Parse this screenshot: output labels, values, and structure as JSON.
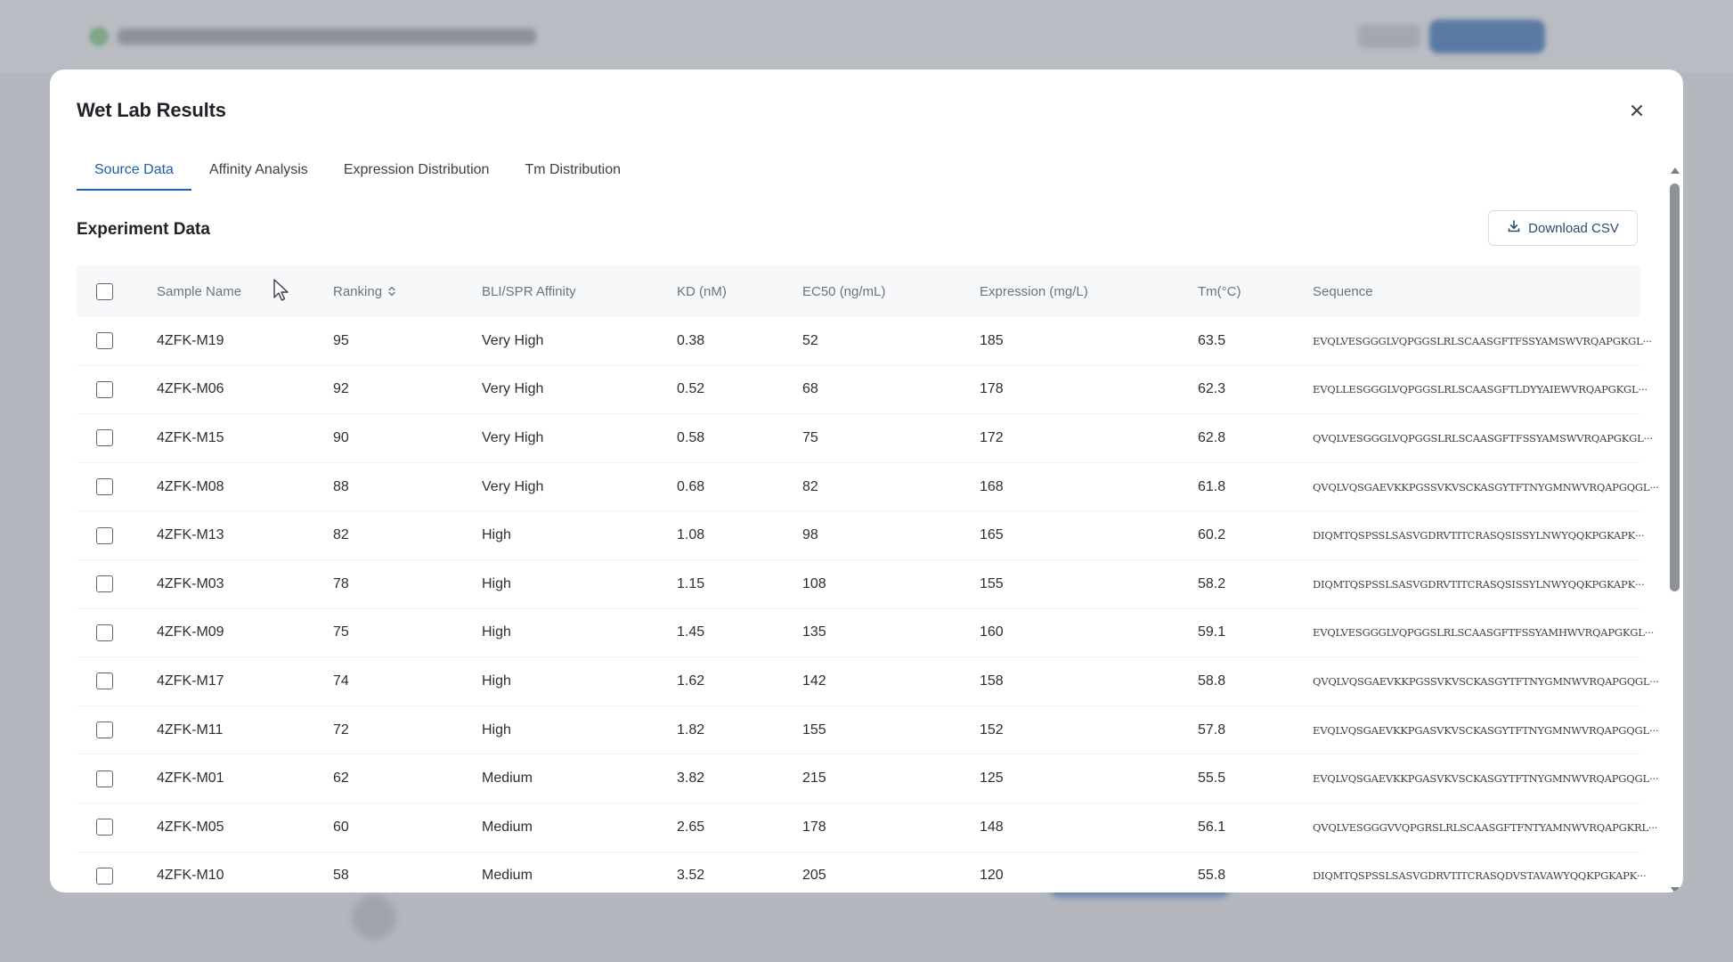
{
  "modal": {
    "title": "Wet Lab Results",
    "close_icon": "close-icon"
  },
  "tabs": [
    {
      "label": "Source Data",
      "active": true
    },
    {
      "label": "Affinity Analysis",
      "active": false
    },
    {
      "label": "Expression Distribution",
      "active": false
    },
    {
      "label": "Tm Distribution",
      "active": false
    }
  ],
  "section": {
    "title": "Experiment Data",
    "download_label": "Download CSV",
    "download_icon": "download-icon"
  },
  "table": {
    "headers": {
      "name": "Sample Name",
      "ranking": "Ranking",
      "affinity": "BLI/SPR Affinity",
      "kd": "KD (nM)",
      "ec50": "EC50 (ng/mL)",
      "expression": "Expression (mg/L)",
      "tm": "Tm(°C)",
      "sequence": "Sequence"
    },
    "rows": [
      {
        "name": "4ZFK-M19",
        "ranking": "95",
        "affinity": "Very High",
        "kd": "0.38",
        "ec50": "52",
        "expression": "185",
        "tm": "63.5",
        "sequence": "EVQLVESGGGLVQPGGSLRLSCAASGFTFSSYAMSWVRQAPGKGL···"
      },
      {
        "name": "4ZFK-M06",
        "ranking": "92",
        "affinity": "Very High",
        "kd": "0.52",
        "ec50": "68",
        "expression": "178",
        "tm": "62.3",
        "sequence": "EVQLLESGGGLVQPGGSLRLSCAASGFTLDYYAIEWVRQAPGKGL···"
      },
      {
        "name": "4ZFK-M15",
        "ranking": "90",
        "affinity": "Very High",
        "kd": "0.58",
        "ec50": "75",
        "expression": "172",
        "tm": "62.8",
        "sequence": "QVQLVESGGGLVQPGGSLRLSCAASGFTFSSYAMSWVRQAPGKGL···"
      },
      {
        "name": "4ZFK-M08",
        "ranking": "88",
        "affinity": "Very High",
        "kd": "0.68",
        "ec50": "82",
        "expression": "168",
        "tm": "61.8",
        "sequence": "QVQLVQSGAEVKKPGSSVKVSCKASGYTFTNYGMNWVRQAPGQGL···"
      },
      {
        "name": "4ZFK-M13",
        "ranking": "82",
        "affinity": "High",
        "kd": "1.08",
        "ec50": "98",
        "expression": "165",
        "tm": "60.2",
        "sequence": "DIQMTQSPSSLSASVGDRVTITCRASQSISSYLNWYQQKPGKAPK···"
      },
      {
        "name": "4ZFK-M03",
        "ranking": "78",
        "affinity": "High",
        "kd": "1.15",
        "ec50": "108",
        "expression": "155",
        "tm": "58.2",
        "sequence": "DIQMTQSPSSLSASVGDRVTITCRASQSISSYLNWYQQKPGKAPK···"
      },
      {
        "name": "4ZFK-M09",
        "ranking": "75",
        "affinity": "High",
        "kd": "1.45",
        "ec50": "135",
        "expression": "160",
        "tm": "59.1",
        "sequence": "EVQLVESGGGLVQPGGSLRLSCAASGFTFSSYAMHWVRQAPGKGL···"
      },
      {
        "name": "4ZFK-M17",
        "ranking": "74",
        "affinity": "High",
        "kd": "1.62",
        "ec50": "142",
        "expression": "158",
        "tm": "58.8",
        "sequence": "QVQLVQSGAEVKKPGSSVKVSCKASGYTFTNYGMNWVRQAPGQGL···"
      },
      {
        "name": "4ZFK-M11",
        "ranking": "72",
        "affinity": "High",
        "kd": "1.82",
        "ec50": "155",
        "expression": "152",
        "tm": "57.8",
        "sequence": "EVQLVQSGAEVKKPGASVKVSCKASGYTFTNYGMNWVRQAPGQGL···"
      },
      {
        "name": "4ZFK-M01",
        "ranking": "62",
        "affinity": "Medium",
        "kd": "3.82",
        "ec50": "215",
        "expression": "125",
        "tm": "55.5",
        "sequence": "EVQLVQSGAEVKKPGASVKVSCKASGYTFTNYGMNWVRQAPGQGL···"
      },
      {
        "name": "4ZFK-M05",
        "ranking": "60",
        "affinity": "Medium",
        "kd": "2.65",
        "ec50": "178",
        "expression": "148",
        "tm": "56.1",
        "sequence": "QVQLVESGGGVVQPGRSLRLSCAASGFTFNTYAMNWVRQAPGKRL···"
      },
      {
        "name": "4ZFK-M10",
        "ranking": "58",
        "affinity": "Medium",
        "kd": "3.52",
        "ec50": "205",
        "expression": "120",
        "tm": "55.8",
        "sequence": "DIQMTQSPSSLSASVGDRVTITCRASQDVSTAVAWYQQKPGKAPK···"
      }
    ]
  },
  "colors": {
    "accent": "#1d5fa8",
    "overlay": "#a9adb3"
  }
}
